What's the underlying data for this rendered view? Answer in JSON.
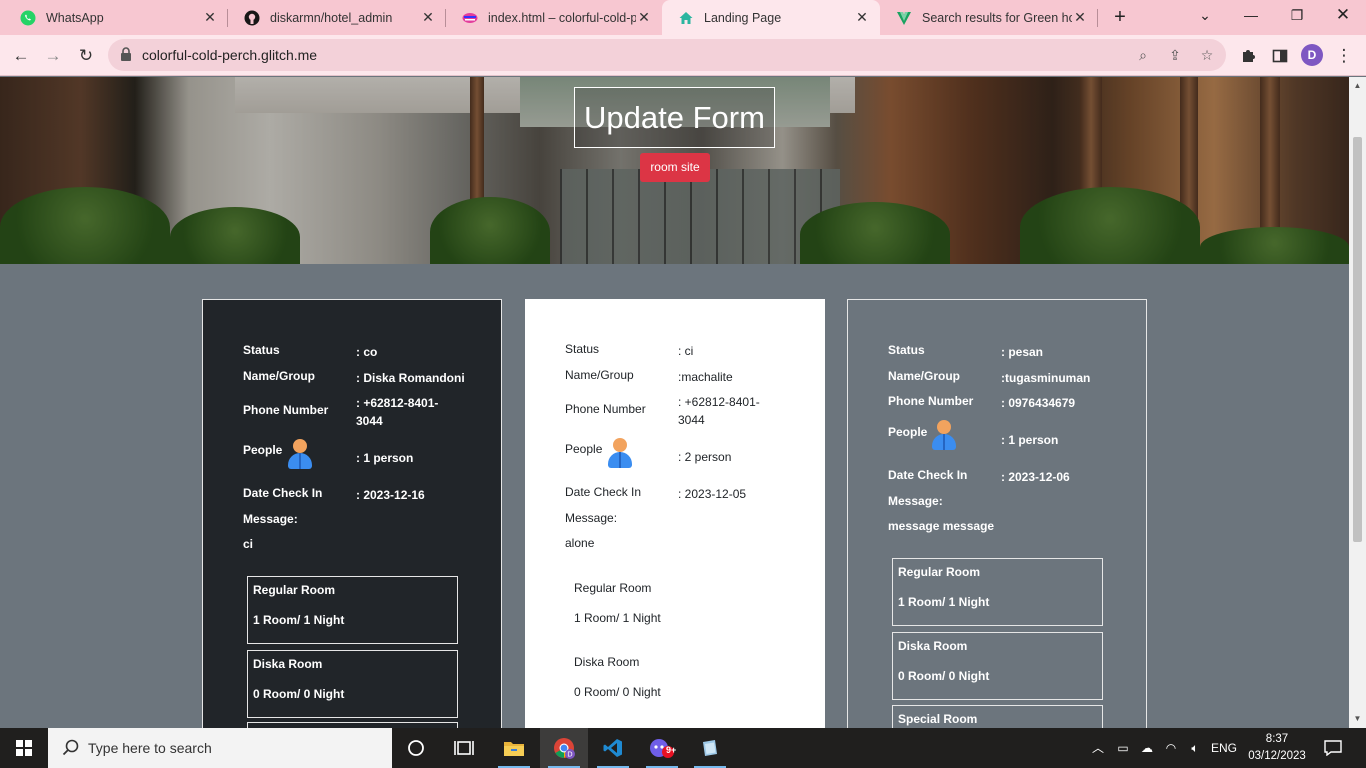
{
  "browser": {
    "tabs": [
      {
        "title": "WhatsApp",
        "icon": "whatsapp-icon",
        "active": false
      },
      {
        "title": "diskarmn/hotel_admin",
        "icon": "github-icon",
        "active": false
      },
      {
        "title": "index.html – colorful-cold-p",
        "icon": "glitch-icon",
        "active": false
      },
      {
        "title": "Landing Page",
        "icon": "house-icon",
        "active": true
      },
      {
        "title": "Search results for Green hot",
        "icon": "vuetify-icon",
        "active": false
      }
    ],
    "url": "colorful-cold-perch.glitch.me",
    "profile_initial": "D"
  },
  "hero": {
    "title": "Update Form",
    "button_label": "room site"
  },
  "labels": {
    "status": "Status",
    "name": "Name/Group",
    "phone": "Phone Number",
    "people": "People",
    "checkin": "Date Check In",
    "message": "Message:"
  },
  "cards": [
    {
      "theme": "dark",
      "status": ": co",
      "name": ": Diska Romandoni",
      "phone": ": +62812-8401-3044",
      "people": ": 1 person",
      "checkin": ": 2023-12-16",
      "message": "ci",
      "rooms": [
        {
          "name": "Regular Room",
          "qty": "1 Room/ 1 Night"
        },
        {
          "name": "Diska Room",
          "qty": "0 Room/ 0 Night"
        }
      ]
    },
    {
      "theme": "light",
      "status": ": ci",
      "name": ":machalite",
      "phone": ": +62812-8401-3044",
      "people": ": 2 person",
      "checkin": ": 2023-12-05",
      "message": "alone",
      "rooms": [
        {
          "name": "Regular Room",
          "qty": "1 Room/ 1 Night"
        },
        {
          "name": "Diska Room",
          "qty": "0 Room/ 0 Night"
        }
      ]
    },
    {
      "theme": "gray",
      "status": ": pesan",
      "name": ":tugasminuman",
      "phone": ": 0976434679",
      "people": ": 1 person",
      "checkin": ": 2023-12-06",
      "message": "message message",
      "rooms": [
        {
          "name": "Regular Room",
          "qty": "1 Room/ 1 Night"
        },
        {
          "name": "Diska Room",
          "qty": "0 Room/ 0 Night"
        },
        {
          "name": "Special Room",
          "qty": ""
        }
      ]
    }
  ],
  "taskbar": {
    "search_placeholder": "Type here to search",
    "language": "ENG",
    "time": "8:37",
    "date": "03/12/2023",
    "notification_badge": "9+"
  },
  "colors": {
    "page_bg": "#6c757d",
    "dark_card": "#212529",
    "button_red": "#dc3545",
    "tab_strip": "#f7c7d1"
  }
}
